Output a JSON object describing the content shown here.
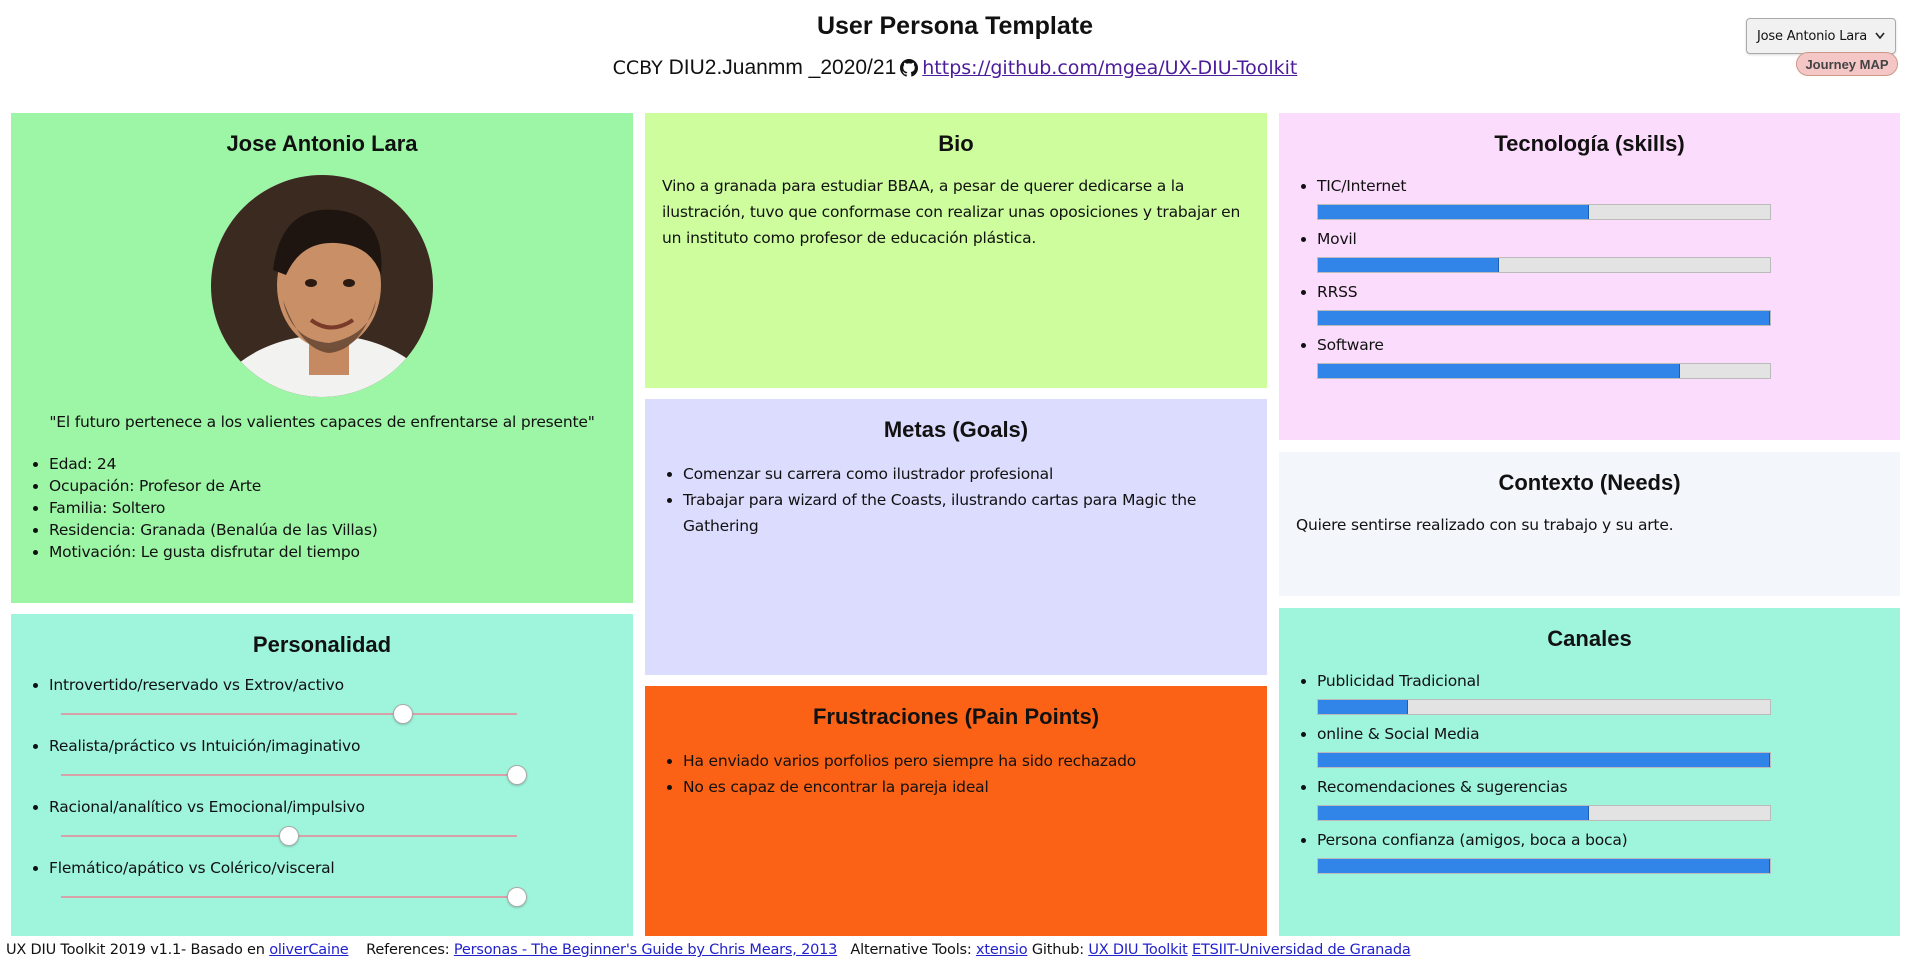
{
  "header": {
    "title": "User Persona Template",
    "cc_text": "CCBY",
    "course": "DIU2.Juanmm _2020/21",
    "repo_link": "https://github.com/mgea/UX-DIU-Toolkit"
  },
  "controls": {
    "persona_select": "Jose Antonio Lara",
    "journey_button": "Journey MAP"
  },
  "profile": {
    "name": "Jose Antonio Lara",
    "quote": "\"El futuro pertenece a los valientes capaces de enfrentarse al presente\"",
    "details": [
      "Edad: 24",
      "Ocupación: Profesor de Arte",
      "Familia: Soltero",
      "Residencia: Granada (Benalúa de las Villas)",
      "Motivación: Le gusta disfrutar del tiempo"
    ]
  },
  "personality": {
    "title": "Personalidad",
    "traits": [
      {
        "label": "Introvertido/reservado vs Extrov/activo",
        "value": 0.75
      },
      {
        "label": "Realista/práctico vs Intuición/imaginativo",
        "value": 1.0
      },
      {
        "label": "Racional/analítico vs Emocional/impulsivo",
        "value": 0.5
      },
      {
        "label": "Flemático/apático vs Colérico/visceral",
        "value": 1.0
      }
    ]
  },
  "bio": {
    "title": "Bio",
    "text": "Vino a granada para estudiar BBAA, a pesar de querer dedicarse a la ilustración, tuvo que conformase con realizar unas oposiciones y trabajar en un instituto como profesor de educación plástica."
  },
  "goals": {
    "title": "Metas (Goals)",
    "items": [
      "Comenzar su carrera como ilustrador profesional",
      "Trabajar para wizard of the Coasts, ilustrando cartas para Magic the Gathering"
    ]
  },
  "pain_points": {
    "title": "Frustraciones (Pain Points)",
    "items": [
      "Ha enviado varios porfolios pero siempre ha sido rechazado",
      "No es capaz de encontrar la pareja ideal"
    ]
  },
  "technology": {
    "title": "Tecnología (skills)",
    "skills": [
      {
        "label": "TIC/Internet",
        "value": 60
      },
      {
        "label": "Movil",
        "value": 40
      },
      {
        "label": "RRSS",
        "value": 100
      },
      {
        "label": "Software",
        "value": 80
      }
    ]
  },
  "context": {
    "title": "Contexto (Needs)",
    "text": "Quiere sentirse realizado con su trabajo y su arte."
  },
  "channels": {
    "title": "Canales",
    "items": [
      {
        "label": "Publicidad Tradicional",
        "value": 20
      },
      {
        "label": "online & Social Media",
        "value": 100
      },
      {
        "label": "Recomendaciones & sugerencias",
        "value": 60
      },
      {
        "label": "Persona confianza (amigos, boca a boca)",
        "value": 100
      }
    ]
  },
  "footer": {
    "toolkit": "UX DIU Toolkit 2019 v1.1- Basado en",
    "based_link": "oliverCaine",
    "references_label": "References:",
    "references_link": "Personas - The Beginner's Guide by Chris Mears, 2013",
    "alt_label": "Alternative Tools:",
    "alt_link": "xtensio",
    "github_label": "Github:",
    "github_link": "UX DIU Toolkit",
    "etsiit_link": "ETSIIT-Universidad de Granada"
  },
  "colors": {
    "profile_bg": "#9df5a6",
    "personality_bg": "#9ef5dc",
    "bio_bg": "#cdfd9d",
    "goals_bg": "#dcdcfe",
    "pain_bg": "#fc6216",
    "tech_bg": "#fcdcfc",
    "context_bg": "#f3f6fa",
    "channels_bg": "#9ef5dc",
    "bar_fill": "#3185e8"
  }
}
